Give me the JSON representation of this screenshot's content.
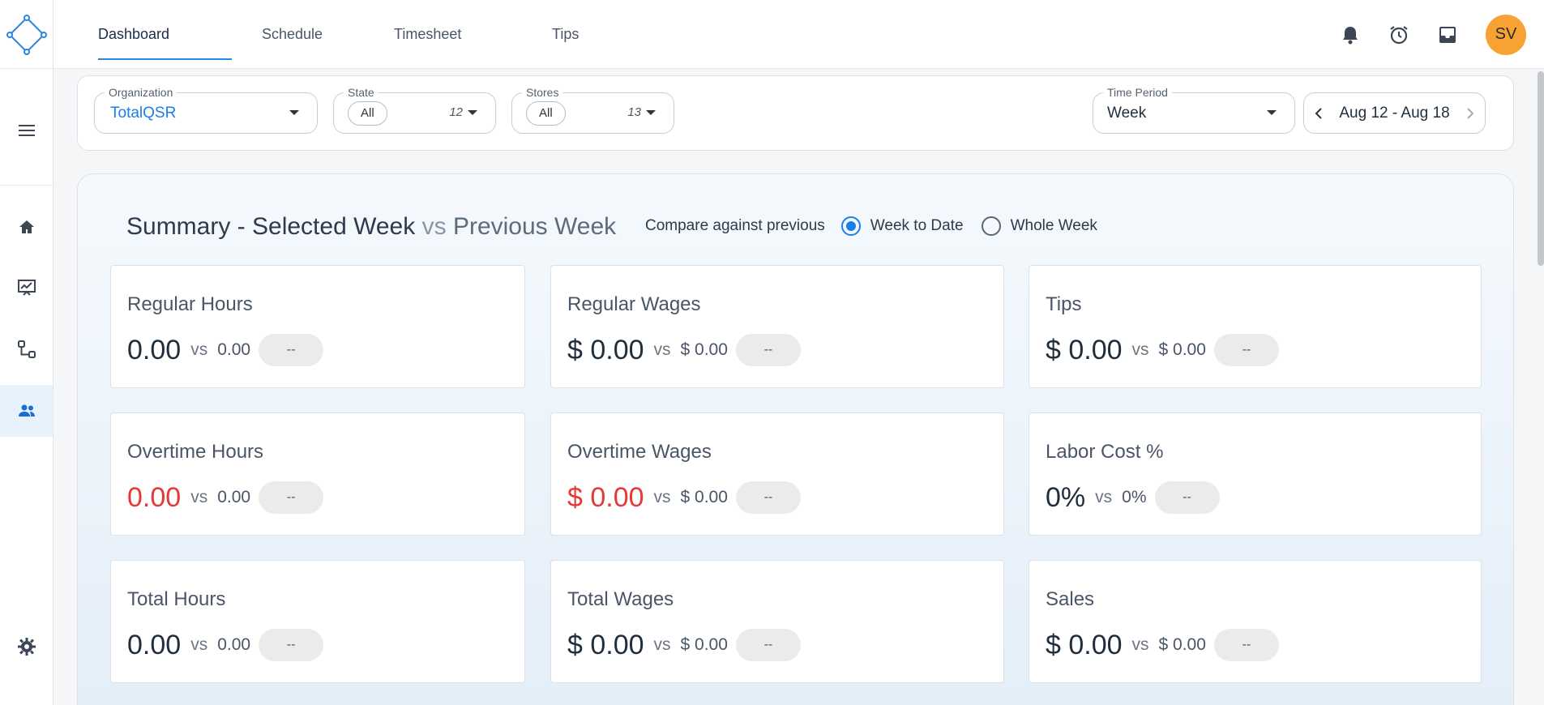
{
  "nav": {
    "tabs": [
      {
        "label": "Dashboard"
      },
      {
        "label": "Schedule"
      },
      {
        "label": "Timesheet"
      },
      {
        "label": "Tips"
      }
    ],
    "active_tab": "Dashboard",
    "avatar_initials": "SV"
  },
  "filters": {
    "organization": {
      "label": "Organization",
      "value": "TotalQSR"
    },
    "state": {
      "label": "State",
      "chip": "All",
      "count": "12"
    },
    "stores": {
      "label": "Stores",
      "chip": "All",
      "count": "13"
    },
    "time_period": {
      "label": "Time Period",
      "value": "Week"
    },
    "date_range": "Aug 12 - Aug 18"
  },
  "summary": {
    "title_main": "Summary - Selected Week",
    "title_vs": "vs",
    "title_prev": "Previous Week",
    "compare_label": "Compare against previous",
    "options": [
      {
        "label": "Week to Date",
        "checked": true
      },
      {
        "label": "Whole Week",
        "checked": false
      }
    ],
    "metrics": [
      {
        "label": "Regular Hours",
        "value": "0.00",
        "vs": "vs",
        "prev": "0.00",
        "delta": "--"
      },
      {
        "label": "Regular Wages",
        "value": "$ 0.00",
        "vs": "vs",
        "prev": "$ 0.00",
        "delta": "--"
      },
      {
        "label": "Tips",
        "value": "$ 0.00",
        "vs": "vs",
        "prev": "$ 0.00",
        "delta": "--"
      },
      {
        "label": "Overtime Hours",
        "value": "0.00",
        "vs": "vs",
        "prev": "0.00",
        "delta": "--"
      },
      {
        "label": "Overtime Wages",
        "value": "$ 0.00",
        "vs": "vs",
        "prev": "$ 0.00",
        "delta": "--"
      },
      {
        "label": "Labor Cost %",
        "value": "0%",
        "vs": "vs",
        "prev": "0%",
        "delta": "--"
      },
      {
        "label": "Total Hours",
        "value": "0.00",
        "vs": "vs",
        "prev": "0.00",
        "delta": "--"
      },
      {
        "label": "Total Wages",
        "value": "$ 0.00",
        "vs": "vs",
        "prev": "$ 0.00",
        "delta": "--"
      },
      {
        "label": "Sales",
        "value": "$ 0.00",
        "vs": "vs",
        "prev": "$ 0.00",
        "delta": "--"
      }
    ]
  },
  "colors": {
    "accent": "#1a7fe8",
    "warning": "#e53935",
    "avatar": "#f7a233"
  },
  "icons": {
    "logo": "diamond-logo-icon",
    "top": [
      "bell-icon",
      "alarm-clock-icon",
      "inbox-icon"
    ],
    "sidebar": [
      "menu-icon",
      "home-icon",
      "analytics-icon",
      "workflow-icon",
      "people-icon",
      "gear-icon"
    ]
  }
}
